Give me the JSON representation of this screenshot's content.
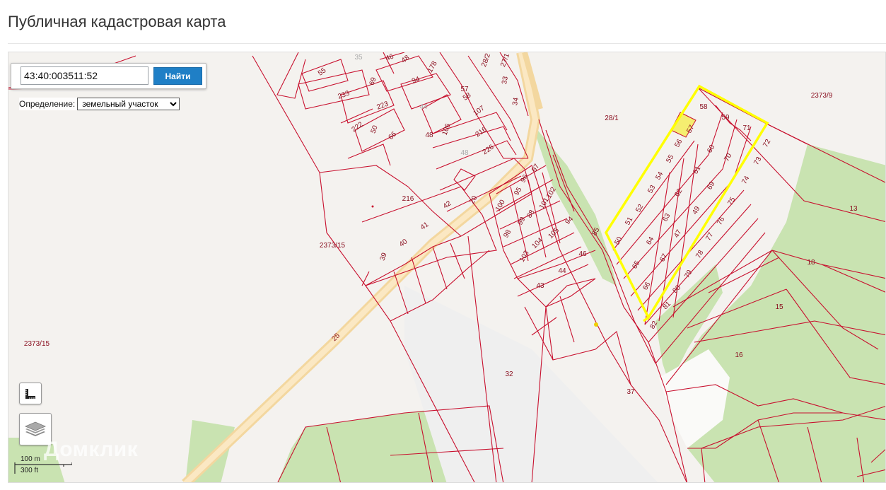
{
  "page": {
    "title": "Публичная кадастровая карта"
  },
  "search": {
    "value": "43:40:003511:52",
    "button_label": "Найти"
  },
  "definition": {
    "label": "Определение:",
    "selected": "земельный участок"
  },
  "scale": {
    "metric": "100 m",
    "imperial": "300 ft"
  },
  "watermark": "Домклик",
  "colors": {
    "boundary": "#c8102e",
    "highlight": "#ffff00",
    "selected_fill": "#f5ee70",
    "forest": "#c9e3b1",
    "road": "#f6dca4",
    "background": "#f4f2ef",
    "button": "#1f7fc6"
  },
  "map": {
    "parcel_labels": [
      "55",
      "35",
      "46",
      "48",
      "178",
      "94",
      "57",
      "69",
      "233",
      "223",
      "222",
      "50",
      "66",
      "44",
      "48",
      "106",
      "58",
      "107",
      "216",
      "226",
      "48",
      "28/2",
      "27/1",
      "33",
      "34",
      "28/1",
      "2373/9",
      "216",
      "42",
      "41",
      "40",
      "39",
      "20",
      "100",
      "95",
      "96",
      "97",
      "102",
      "101",
      "88",
      "99",
      "98",
      "94",
      "105",
      "104",
      "103",
      "44",
      "46",
      "43",
      "2373/15",
      "2373/15",
      "25",
      "32",
      "37",
      "85",
      "58",
      "59",
      "71",
      "72",
      "57",
      "56",
      "60",
      "70",
      "73",
      "55",
      "61",
      "54",
      "69",
      "74",
      "53",
      "62",
      "52",
      "49",
      "75",
      "51",
      "63",
      "76",
      "50",
      "47",
      "64",
      "77",
      "65",
      "67",
      "78",
      "66",
      "79",
      "80",
      "81",
      "82",
      "13",
      "18",
      "15",
      "16"
    ],
    "forest_areas": 6
  }
}
